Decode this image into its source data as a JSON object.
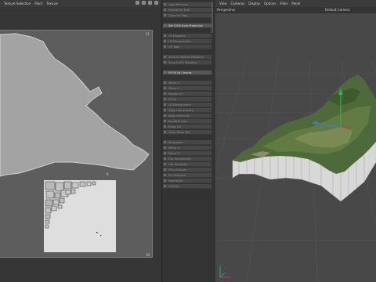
{
  "uv_editor": {
    "menu": [
      "Texture Selection",
      "Paint",
      "Texture"
    ],
    "ticks": {
      "top_right": "11",
      "middle_right": "6",
      "bottom_right": "10"
    }
  },
  "mid_panel": {
    "groups": [
      [
        "Load Previous",
        "Record UV Map",
        "Clear UV Map"
      ],
      [
        "Set UVW from Projection"
      ],
      [
        "UV Mapping",
        "UV Manipulation",
        "UV Tags"
      ],
      [
        "Snap to Texture Mapping",
        "Snap to UV Mapping"
      ],
      [
        "Fit UV to Canvas"
      ],
      [
        "Mirror X",
        "Mirror Y",
        "Rotate 90°",
        "Fit UV",
        "UV Realignment",
        "Align Horizontally",
        "Align Vertically",
        "Equalize Size",
        "Relax UV",
        "Clear Relax Tag"
      ],
      [
        "Straighten",
        "Mirror U",
        "Mirror V",
        "Flip Horizontally",
        "Flip Vertically",
        "Fit to Canvas",
        "Pin Selected",
        "Normalize",
        "Unwrap"
      ]
    ],
    "active_item": "Set UVW from Projection",
    "highlight_item": "Fit UV to Canvas"
  },
  "viewport": {
    "menu": [
      "View",
      "Cameras",
      "Display",
      "Options",
      "Filter",
      "Panel"
    ],
    "view_name": "Perspective",
    "camera": "Default Camera"
  },
  "gizmo": {
    "x_label": "X",
    "y_label": "Y",
    "z_label": "Z"
  }
}
